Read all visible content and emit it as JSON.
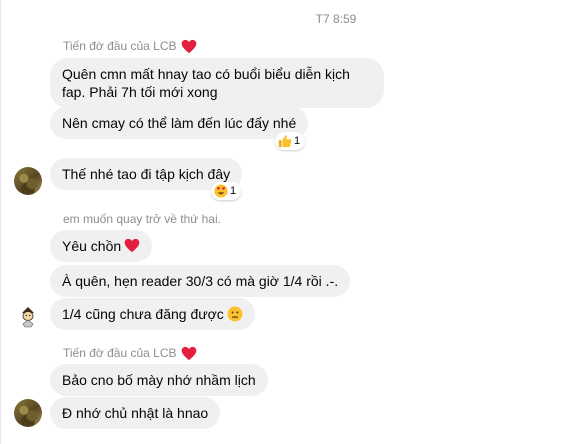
{
  "header": {
    "timestamp": "T7 8:59"
  },
  "groups": [
    {
      "sender_label": "Tiến đờ đầu của LCB",
      "messages": [
        {
          "line1": "Quên cmn mất hnay tao có buổi biểu diễn kịch",
          "line2": "fap. Phải 7h tối mới xong"
        },
        {
          "text": "Nên cmay có thể làm đến lúc đấy nhé",
          "reaction_emoji": "thumbs-up",
          "reaction_count": "1"
        },
        {
          "text": "Thế nhé tao đi tập kịch đây",
          "reaction_emoji": "heart-eyes",
          "reaction_count": "1"
        }
      ]
    },
    {
      "sender_label": "em muốn quay trở về thứ hai.",
      "messages": [
        {
          "text": "Yêu chồn"
        },
        {
          "text": "À quên, hẹn reader 30/3 có mà giờ 1/4 rồi .-."
        },
        {
          "text": "1/4 cũng chưa đăng được"
        }
      ]
    },
    {
      "sender_label": "Tiến đờ đầu của LCB",
      "messages": [
        {
          "text": "Bảo cno bố mày nhớ nhầm lịch"
        },
        {
          "text": "Đ nhớ chủ nhật là hnao"
        }
      ]
    }
  ],
  "colors": {
    "bubble": "#f0f0f0",
    "heart": "#e41e3f",
    "meta_text": "#8a8d91"
  }
}
